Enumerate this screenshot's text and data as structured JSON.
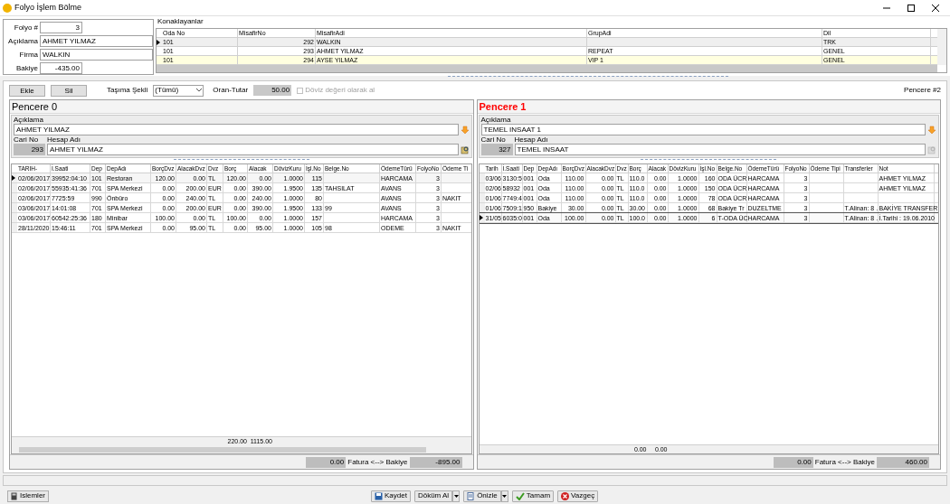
{
  "window": {
    "title": "Folyo İşlem Bölme"
  },
  "header": {
    "folyo_label": "Folyo #",
    "folyo_value": "3",
    "aciklama_label": "Açıklama",
    "aciklama_value": "AHMET YILMAZ",
    "firma_label": "Firma",
    "firma_value": "WALKIN",
    "bakiye_label": "Bakiye",
    "bakiye_value": "-435.00"
  },
  "guests": {
    "title": "Konaklayanlar",
    "columns": [
      "Oda No",
      "MisafirNo",
      "MisafirAdi",
      "GrupAdi",
      "Dil"
    ],
    "rows": [
      {
        "selected": true,
        "highlighted": false,
        "cells": [
          "101",
          "292",
          "WALKIN",
          "",
          "TRK"
        ]
      },
      {
        "selected": false,
        "highlighted": false,
        "cells": [
          "101",
          "293",
          "AHMET YILMAZ",
          "REPEAT",
          "GENEL"
        ]
      },
      {
        "selected": false,
        "highlighted": true,
        "cells": [
          "101",
          "294",
          "AYSE YILMAZ",
          "VIP 1",
          "GENEL"
        ]
      }
    ]
  },
  "toolbar": {
    "buttons": [
      "Ekle",
      "Sil"
    ],
    "tasima_label": "Taşıma Şekli",
    "tasima_value": "(Tümü)",
    "oran_label": "Oran-Tutar",
    "oran_value": "50.00",
    "checkbox_label": "Döviz değeri olarak al",
    "checkbox_checked": false,
    "window_label": "Pencere #2"
  },
  "panels": [
    {
      "title": "Pencere 0",
      "active": false,
      "aciklama_label": "Açıklama",
      "aciklama_value": "AHMET YILMAZ",
      "cari_label": "Cari No",
      "hesap_label": "Hesap Adı",
      "cari_value": "293",
      "hesap_value": "AHMET YILMAZ",
      "lookup_enabled": true,
      "columns": [
        {
          "label": "TARIH-"
        },
        {
          "label": "İ.Saati"
        },
        {
          "label": "Dep"
        },
        {
          "label": "DepAdı"
        },
        {
          "label": "BorçDvz"
        },
        {
          "label": "AlacakDvz"
        },
        {
          "label": "Dvz"
        },
        {
          "label": "Borç",
          "total": "220.00"
        },
        {
          "label": "Alacak",
          "total": "1115.00"
        },
        {
          "label": "DövizKuru"
        },
        {
          "label": "İşl.No"
        },
        {
          "label": "Belge.No"
        },
        {
          "label": "ÖdemeTürü"
        },
        {
          "label": "FolyoNo"
        },
        {
          "label": "Ödeme Ti"
        }
      ],
      "rows": [
        {
          "selected": true,
          "cells": [
            "02/06/2017",
            "39952:04:10",
            "101",
            "Restoran",
            "120.00",
            "0.00",
            "TL",
            "120.00",
            "0.00",
            "1.0000",
            "115",
            "",
            "HARCAMA",
            "3",
            ""
          ]
        },
        {
          "selected": false,
          "cells": [
            "02/06/2017",
            "55935:41:36",
            "701",
            "SPA Merkezi",
            "0.00",
            "200.00",
            "EUR",
            "0.00",
            "390.00",
            "1.9500",
            "135",
            "TAHSILAT",
            "AVANS",
            "3",
            ""
          ]
        },
        {
          "selected": false,
          "cells": [
            "02/06/2017",
            "7725:59",
            "990",
            "Önbüro",
            "0.00",
            "240.00",
            "TL",
            "0.00",
            "240.00",
            "1.0000",
            "80",
            "",
            "AVANS",
            "3",
            "NAKIT"
          ]
        },
        {
          "selected": false,
          "cells": [
            "03/06/2017",
            "14:01:08",
            "701",
            "SPA Merkezi",
            "0.00",
            "200.00",
            "EUR",
            "0.00",
            "390.00",
            "1.9500",
            "133",
            "99",
            "AVANS",
            "3",
            ""
          ]
        },
        {
          "selected": false,
          "cells": [
            "03/06/2017",
            "60542:25:36",
            "180",
            "Minibar",
            "100.00",
            "0.00",
            "TL",
            "100.00",
            "0.00",
            "1.0000",
            "157",
            "",
            "HARCAMA",
            "3",
            ""
          ]
        },
        {
          "selected": false,
          "cells": [
            "28/11/2020",
            "15:46:11",
            "701",
            "SPA Merkezi",
            "0.00",
            "95.00",
            "TL",
            "0.00",
            "95.00",
            "1.0000",
            "105",
            "98",
            "ODEME",
            "3",
            "NAKIT"
          ]
        }
      ],
      "fatura_value": "0.00",
      "fatura_label": "Fatura <--> Bakiye",
      "bakiye_value": "-895.00"
    },
    {
      "title": "Pencere 1",
      "active": true,
      "aciklama_label": "Açıklama",
      "aciklama_value": "TEMEL INSAAT 1",
      "cari_label": "Cari No",
      "hesap_label": "Hesap Adı",
      "cari_value": "327",
      "hesap_value": "TEMEL INSAAT",
      "lookup_enabled": false,
      "columns": [
        {
          "label": "Tarih"
        },
        {
          "label": "İ.Saati"
        },
        {
          "label": "Dep"
        },
        {
          "label": "DepAdı"
        },
        {
          "label": "BorçDvz"
        },
        {
          "label": "AlacakDvz"
        },
        {
          "label": "Dvz"
        },
        {
          "label": "Borç",
          "total": "0.00"
        },
        {
          "label": "Alacak",
          "total": "0.00"
        },
        {
          "label": "DövizKuru"
        },
        {
          "label": "İşl.No"
        },
        {
          "label": "Belge.No"
        },
        {
          "label": "ÖdemeTürü"
        },
        {
          "label": "FolyoNo"
        },
        {
          "label": "Ödeme Tipi"
        },
        {
          "label": "Transferler"
        },
        {
          "label": "Not"
        }
      ],
      "rows": [
        {
          "selected": false,
          "cells": [
            "03/06",
            "3130:5",
            "001",
            "Oda",
            "110.00",
            "0.00",
            "TL",
            "110.0",
            "0.00",
            "1.0000",
            "160",
            "ODA ÜCR",
            "HARCAMA",
            "3",
            "",
            "",
            "AHMET YILMAZ"
          ]
        },
        {
          "selected": false,
          "cells": [
            "02/06",
            "58932",
            "001",
            "Oda",
            "110.00",
            "0.00",
            "TL",
            "110.0",
            "0.00",
            "1.0000",
            "150",
            "ODA ÜCR",
            "HARCAMA",
            "3",
            "",
            "",
            "AHMET YILMAZ"
          ]
        },
        {
          "selected": false,
          "cells": [
            "01/06",
            "7749:4",
            "001",
            "Oda",
            "110.00",
            "0.00",
            "TL",
            "110.0",
            "0.00",
            "1.0000",
            "78",
            "ODA ÜCR",
            "HARCAMA",
            "3",
            "",
            "",
            ""
          ]
        },
        {
          "selected": false,
          "cells": [
            "01/06",
            "7509:1",
            "950",
            "Bakiye",
            "30.00",
            "0.00",
            "TL",
            "30.00",
            "0.00",
            "1.0000",
            "68",
            "Bakiye Tr",
            "DUZELTME",
            "3",
            "",
            "T.Alinan: 8 .",
            "BAKİYE TRANSFER"
          ]
        },
        {
          "selected": true,
          "cells": [
            "31/05",
            "6035:0",
            "001",
            "Oda",
            "100.00",
            "0.00",
            "TL",
            "100.0",
            "0.00",
            "1.0000",
            "6",
            "T-ODA ÜC",
            "HARCAMA",
            "3",
            "",
            "T.Alinan: 8 .",
            "İ.Tarihi : 19.06.2010"
          ]
        }
      ],
      "fatura_value": "0.00",
      "fatura_label": "Fatura <--> Bakiye",
      "bakiye_value": "460.00"
    }
  ],
  "bottom": {
    "left_button": "Islemler",
    "buttons": [
      {
        "label": "Kaydet",
        "kind": "save",
        "dropdown": false
      },
      {
        "label": "Döküm Al",
        "kind": "print",
        "dropdown": true
      },
      {
        "label": "Önizle",
        "kind": "preview",
        "dropdown": true
      },
      {
        "label": "Tamam",
        "kind": "ok",
        "dropdown": false
      },
      {
        "label": "Vazgeç",
        "kind": "cancel",
        "dropdown": false
      }
    ]
  }
}
